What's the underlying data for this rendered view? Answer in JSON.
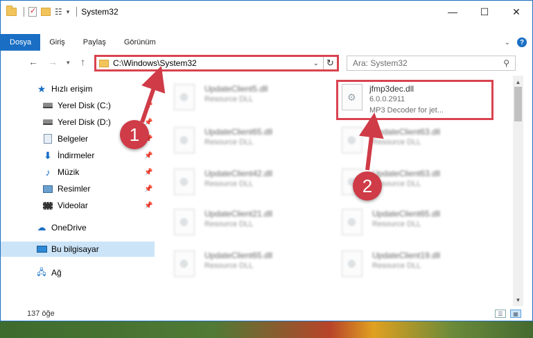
{
  "window": {
    "title": "System32",
    "controls": {
      "minimize": "—",
      "maximize": "☐",
      "close": "✕"
    }
  },
  "ribbon": {
    "tabs": [
      "Dosya",
      "Giriş",
      "Paylaş",
      "Görünüm"
    ],
    "help": "?"
  },
  "nav": {
    "address": "C:\\Windows\\System32",
    "search_placeholder": "Ara: System32"
  },
  "sidebar": {
    "items": [
      {
        "label": "Hızlı erişim",
        "icon": "star-icon",
        "pinned": false
      },
      {
        "label": "Yerel Disk (C:)",
        "icon": "disk-icon",
        "pinned": true
      },
      {
        "label": "Yerel Disk (D:)",
        "icon": "disk-icon",
        "pinned": true
      },
      {
        "label": "Belgeler",
        "icon": "documents-icon",
        "pinned": true
      },
      {
        "label": "İndirmeler",
        "icon": "download-icon",
        "pinned": true
      },
      {
        "label": "Müzik",
        "icon": "music-icon",
        "pinned": true
      },
      {
        "label": "Resimler",
        "icon": "pictures-icon",
        "pinned": true
      },
      {
        "label": "Videolar",
        "icon": "videos-icon",
        "pinned": true
      },
      {
        "label": "OneDrive",
        "icon": "cloud-icon",
        "pinned": false
      },
      {
        "label": "Bu bilgisayar",
        "icon": "computer-icon",
        "pinned": false,
        "selected": true
      },
      {
        "label": "Ağ",
        "icon": "network-icon",
        "pinned": false
      }
    ]
  },
  "files": {
    "left": [
      {
        "name": "UpdateClient5.dll",
        "type": "Resource DLL"
      },
      {
        "name": "UpdateClient65.dll",
        "type": "Resource DLL"
      },
      {
        "name": "UpdateClient42.dll",
        "type": "Resource DLL"
      },
      {
        "name": "UpdateClient21.dll",
        "type": "Resource DLL"
      },
      {
        "name": "UpdateClient65.dll",
        "type": "Resource DLL"
      }
    ],
    "right": [
      {
        "name": "jfmp3dec.dll",
        "version": "6.0.0.2911",
        "type": "MP3 Decoder for jet...",
        "highlighted": true
      },
      {
        "name": "UpdateClient63.dll",
        "type": "Resource DLL"
      },
      {
        "name": "UpdateClient63.dll",
        "type": "Resource DLL"
      },
      {
        "name": "UpdateClient65.dll",
        "type": "Resource DLL"
      },
      {
        "name": "UpdateClient19.dll",
        "type": "Resource DLL"
      }
    ]
  },
  "status": {
    "count": "137 öğe"
  },
  "annotations": {
    "badge1": "1",
    "badge2": "2",
    "color": "#cf3b47"
  }
}
